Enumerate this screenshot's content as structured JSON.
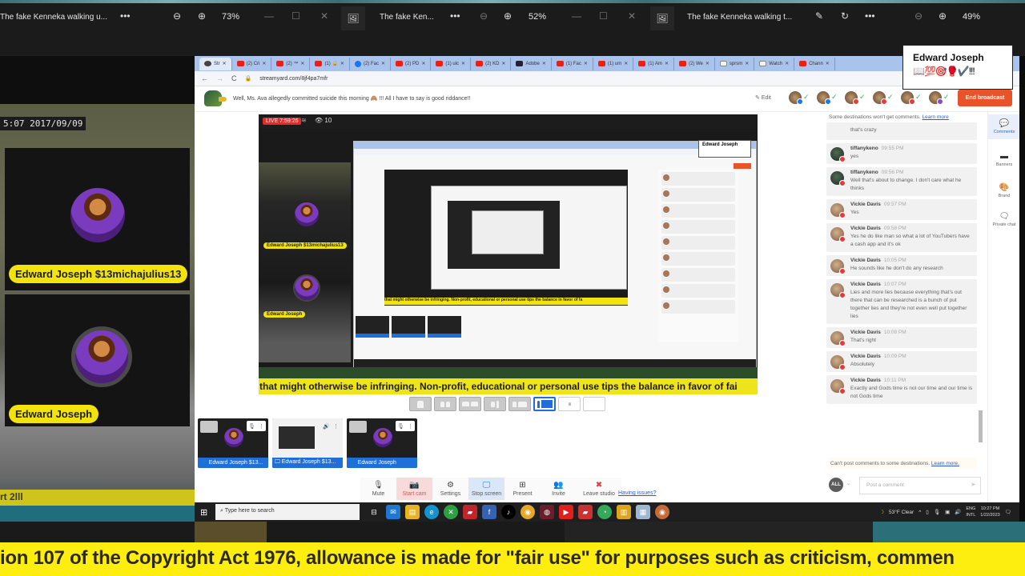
{
  "viewers": [
    {
      "title": "The fake Kenneka walking u...",
      "zoom": "73%"
    },
    {
      "title": "The fake Ken...",
      "zoom": "52%"
    },
    {
      "title": "The fake Kenneka walking t...",
      "zoom": "49%"
    }
  ],
  "left_overlay": {
    "cctv_timestamp": "5:07  2017/09/09",
    "cam1_name": "Edward Joseph $13michajulius13",
    "cam2_name": "Edward Joseph",
    "ticker_fragment": "rt 2lll"
  },
  "name_popup": {
    "name": "Edward Joseph",
    "emoji": "📖💯🎯🥊✔️!!!"
  },
  "browser": {
    "tabs": [
      {
        "label": "Str",
        "icon": "streamyard",
        "active": true
      },
      {
        "label": "(2) Cri",
        "icon": "youtube"
      },
      {
        "label": "(2) ™",
        "icon": "youtube"
      },
      {
        "label": "(1) 🔒",
        "icon": "youtube"
      },
      {
        "label": "(2) Fac",
        "icon": "facebook"
      },
      {
        "label": "(2) PD",
        "icon": "youtube"
      },
      {
        "label": "(1) uic",
        "icon": "youtube"
      },
      {
        "label": "(2) KD",
        "icon": "youtube"
      },
      {
        "label": "Adobe",
        "icon": "adobe"
      },
      {
        "label": "(1) Fac",
        "icon": "youtube"
      },
      {
        "label": "(1) um",
        "icon": "youtube"
      },
      {
        "label": "(1) Am",
        "icon": "youtube"
      },
      {
        "label": "(2) We",
        "icon": "youtube"
      },
      {
        "label": "sprsm",
        "icon": "other"
      },
      {
        "label": "Watch",
        "icon": "amazon"
      },
      {
        "label": "Chann",
        "icon": "youtube"
      }
    ],
    "url": "streamyard.com/8jf4pa7mfr"
  },
  "studio": {
    "broadcast_title": "Well, Ms. Ava allegedly committed suicide this morning 🙈 !!! All I have to say is good riddance!!",
    "edit_label": "Edit",
    "destinations": [
      {
        "platform": "facebook"
      },
      {
        "platform": "facebook"
      },
      {
        "platform": "youtube"
      },
      {
        "platform": "youtube"
      },
      {
        "platform": "youtube"
      },
      {
        "platform": "twitch"
      }
    ],
    "end_broadcast_label": "End broadcast",
    "live_badge": "LIVE 7:59:26",
    "viewer_count": "10",
    "stage_ticker": "that might otherwise be infringing. Non-profit, educational or personal use tips the balance in favor of fai",
    "nested_ticker": "that might otherwise be infringing. Non-profit, educational or personal use tips the balance in favor of fa",
    "layouts_selected_index": 5,
    "thumbnails": [
      {
        "label": "Edward Joseph $13...",
        "type": "camera"
      },
      {
        "label": "Edward Joseph $13...",
        "type": "screen"
      },
      {
        "label": "Edward Joseph",
        "type": "camera"
      }
    ],
    "controls": [
      {
        "label": "Mute",
        "icon": "🎙"
      },
      {
        "label": "Start cam",
        "icon": "📷"
      },
      {
        "label": "Settings",
        "icon": "⚙"
      },
      {
        "label": "Stop screen",
        "icon": "🖵"
      },
      {
        "label": "Present",
        "icon": "⊞"
      },
      {
        "label": "Invite",
        "icon": "👥"
      },
      {
        "label": "Leave studio",
        "icon": "✖"
      }
    ],
    "having_issues": "Having issues?"
  },
  "comments": {
    "notice": "Some destinations won't get comments.",
    "notice_link": "Learn more",
    "first_partial": "that's crazy",
    "items": [
      {
        "name": "tiffanykeno",
        "time": "09:55 PM",
        "message": "yes",
        "avatar": "t"
      },
      {
        "name": "tiffanykeno",
        "time": "09:56 PM",
        "message": "Well that's about to change. I don't care what he thinks",
        "avatar": "t"
      },
      {
        "name": "Vickie Davis",
        "time": "09:57 PM",
        "message": "Yes",
        "avatar": "v"
      },
      {
        "name": "Vickie Davis",
        "time": "09:58 PM",
        "message": "Yes he do like man so what a lot of YouTubers have a cash app and it's ok",
        "avatar": "v"
      },
      {
        "name": "Vickie Davis",
        "time": "10:05 PM",
        "message": "He sounds like he don't do any research",
        "avatar": "v"
      },
      {
        "name": "Vickie Davis",
        "time": "10:07 PM",
        "message": "Lies and more lies because everything that's out there that can be researched is a bunch of put together lies and they're not even well put together lies",
        "avatar": "v"
      },
      {
        "name": "Vickie Davis",
        "time": "10:08 PM",
        "message": "That's right",
        "avatar": "v"
      },
      {
        "name": "Vickie Davis",
        "time": "10:09 PM",
        "message": "Absolutely",
        "avatar": "v"
      },
      {
        "name": "Vickie Davis",
        "time": "10:11 PM",
        "message": "Exactly and Gods time is not our time and our time is not Gods time",
        "avatar": "v"
      }
    ],
    "footer": "Can't post comments to some destinations.",
    "footer_link": "Learn more.",
    "audience_label": "ALL",
    "input_placeholder": "Post a comment"
  },
  "rail": [
    {
      "label": "Comments",
      "icon": "💬",
      "active": true
    },
    {
      "label": "Banners",
      "icon": "▬"
    },
    {
      "label": "Brand",
      "icon": "🎨"
    },
    {
      "label": "Private chat",
      "icon": "🗨"
    }
  ],
  "taskbar": {
    "search_placeholder": "Type here to search",
    "weather": "53°F  Clear",
    "lang_top": "ENG",
    "lang_bottom": "INTL",
    "time": "10:27 PM",
    "date": "1/22/2023"
  },
  "bottom_ticker": "ion 107 of the Copyright Act 1976, allowance is made for \"fair use\" for purposes such as criticism, commen"
}
